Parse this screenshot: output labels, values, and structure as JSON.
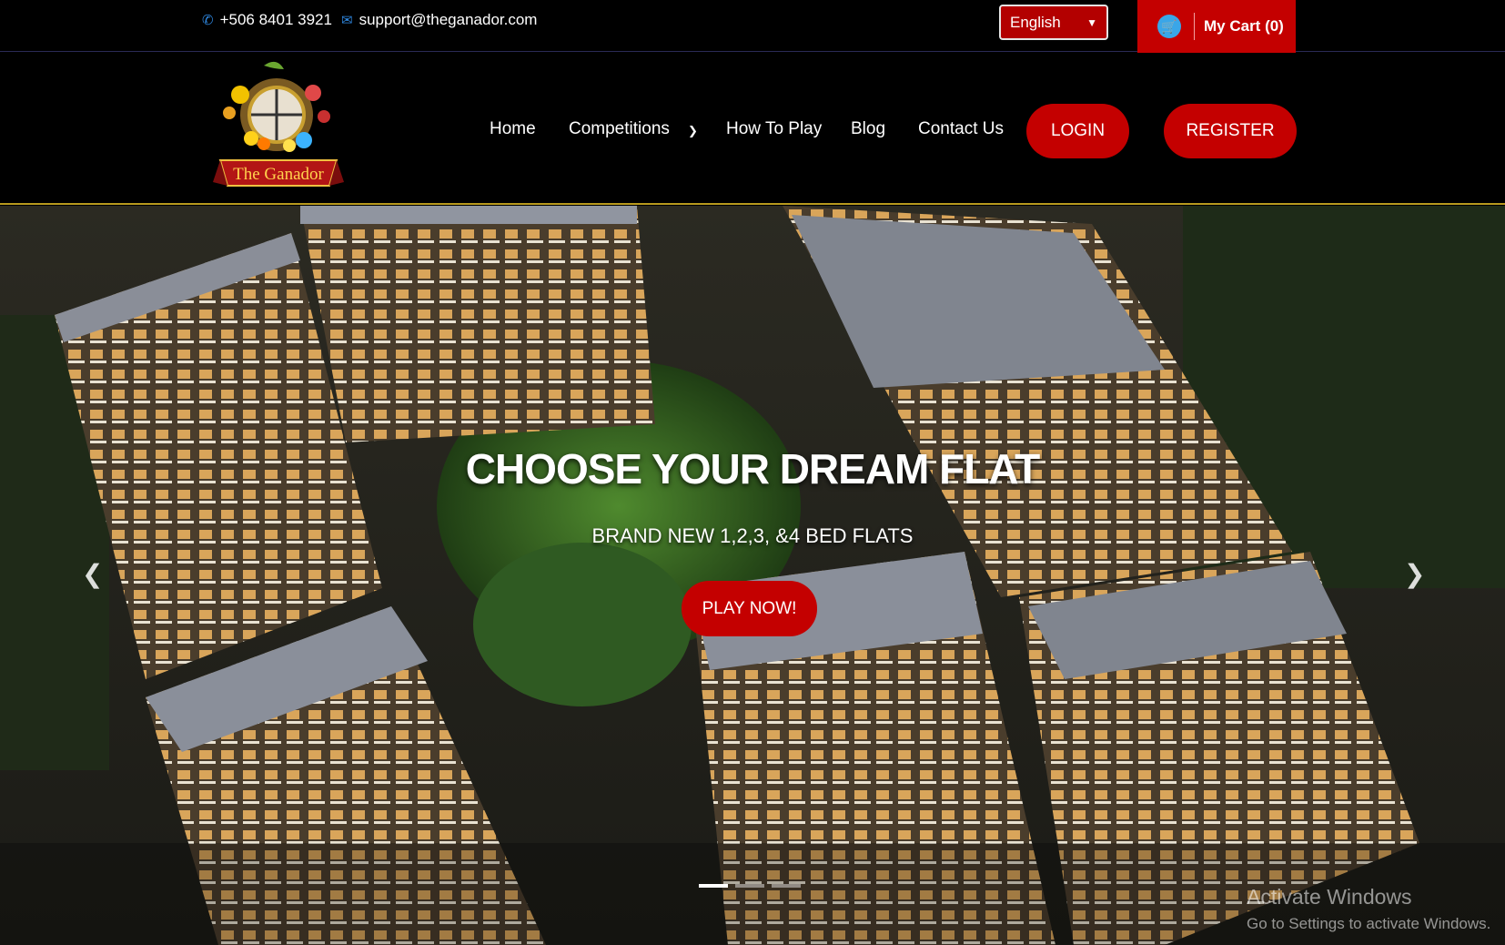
{
  "topbar": {
    "phone": "+506 8401 3921",
    "email": "support@theganador.com",
    "language": "English",
    "cart_label": "My Cart (0)"
  },
  "logo": {
    "text": "The Ganador"
  },
  "nav": {
    "home": "Home",
    "competitions": "Competitions",
    "how_to_play": "How To Play",
    "blog": "Blog",
    "contact": "Contact Us",
    "login": "LOGIN",
    "register": "REGISTER"
  },
  "hero": {
    "title": "CHOOSE YOUR DREAM FLAT",
    "subtitle": "BRAND NEW 1,2,3, &4 BED FLATS",
    "button": "PLAY NOW!",
    "slides": 3,
    "active_slide": 1
  },
  "watermark": {
    "line1": "Activate Windows",
    "line2": "Go to Settings to activate Windows."
  },
  "icons": {
    "phone": "phone-icon",
    "email": "envelope-icon",
    "cart": "cart-icon",
    "prev": "chevron-left-icon",
    "next": "chevron-right-icon"
  },
  "colors": {
    "accent_red": "#c40000",
    "nav_border": "#b89a1e",
    "cart_icon": "#3aa6e8",
    "contact_icon": "#2e86de"
  }
}
